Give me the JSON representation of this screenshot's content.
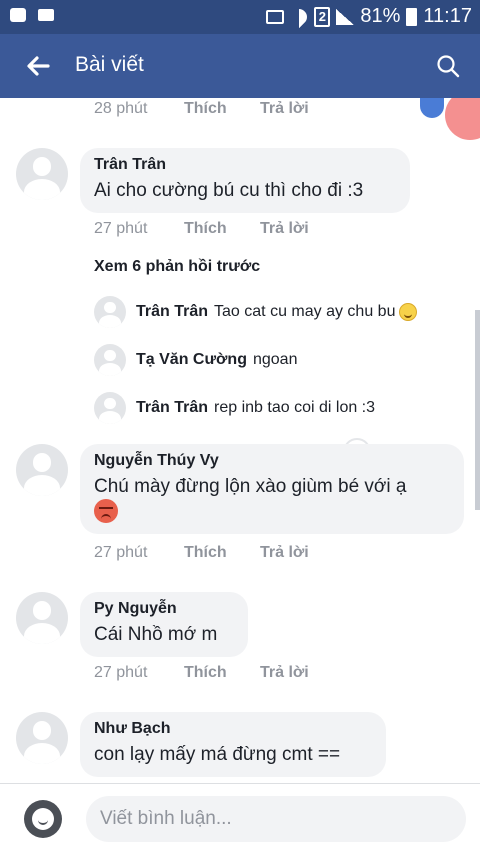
{
  "status_bar": {
    "battery": "81%",
    "time": "11:17",
    "sim": "2"
  },
  "app_bar": {
    "title": "Bài viết"
  },
  "top_meta": {
    "time": "28 phút",
    "like": "Thích",
    "reply": "Trả lời"
  },
  "comments": [
    {
      "name": "Trân Trân",
      "text": "Ai cho cường bú cu thì cho đi :3",
      "time": "27 phút",
      "like": "Thích",
      "reply": "Trả lời"
    },
    {
      "name": "Nguyễn Thúy Vy",
      "text": "Chú mày đừng lộn xào giùm bé với ạ",
      "emoji": "angry-face-icon",
      "time": "27 phút",
      "like": "Thích",
      "reply": "Trả lời"
    },
    {
      "name": "Py Nguyễn",
      "text": "Cái Nhồ mớ m",
      "time": "27 phút",
      "like": "Thích",
      "reply": "Trả lời"
    },
    {
      "name": "Như Bạch",
      "text": "con lạy mấy má đừng cmt =="
    }
  ],
  "view_previous": "Xem 6 phản hồi trước",
  "replies": [
    {
      "name": "Trân Trân",
      "text": "Tao cat cu may ay chu bu",
      "emoji": "smile-icon"
    },
    {
      "name": "Tạ Văn Cường",
      "text": "ngoan"
    },
    {
      "name": "Trân Trân",
      "text": "rep inb tao coi di lon :3"
    }
  ],
  "composer": {
    "placeholder": "Viết bình luận..."
  }
}
